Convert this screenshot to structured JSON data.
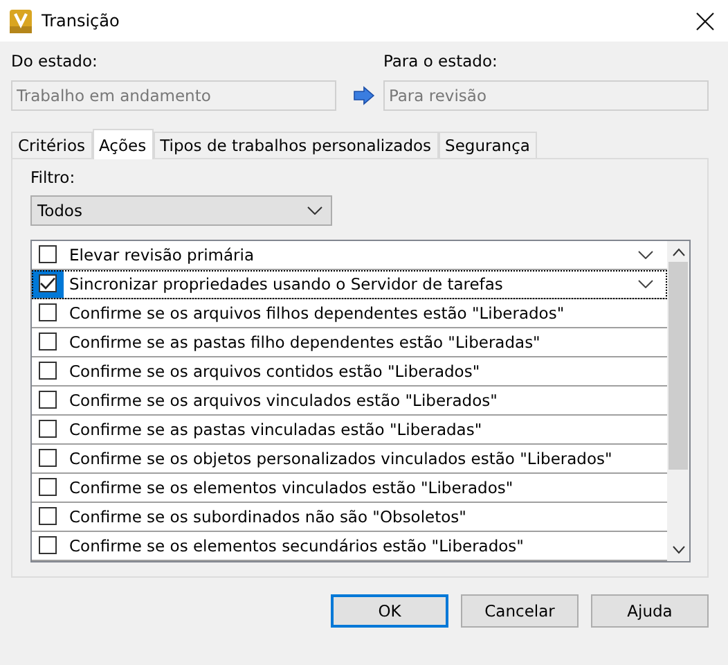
{
  "window": {
    "title": "Transição"
  },
  "from_state": {
    "label": "Do estado:",
    "value": "Trabalho em andamento",
    "disabled": true
  },
  "to_state": {
    "label": "Para o estado:",
    "value": "Para revisão",
    "disabled": true
  },
  "tabs": [
    {
      "label": "Critérios",
      "selected": false
    },
    {
      "label": "Ações",
      "selected": true
    },
    {
      "label": "Tipos de trabalhos personalizados",
      "selected": false
    },
    {
      "label": "Segurança",
      "selected": false
    }
  ],
  "filter": {
    "label": "Filtro:",
    "value": "Todos"
  },
  "actions": [
    {
      "label": "Elevar revisão primária",
      "checked": false,
      "selected": false,
      "kind": "expandable"
    },
    {
      "label": "Sincronizar propriedades usando o Servidor de tarefas",
      "checked": true,
      "selected": true,
      "kind": "expandable"
    },
    {
      "label": "Confirme se os arquivos filhos dependentes estão \"Liberados\"",
      "checked": false,
      "selected": false,
      "kind": "plain"
    },
    {
      "label": "Confirme se as pastas filho dependentes estão \"Liberadas\"",
      "checked": false,
      "selected": false,
      "kind": "plain"
    },
    {
      "label": "Confirme se os arquivos contidos estão \"Liberados\"",
      "checked": false,
      "selected": false,
      "kind": "plain"
    },
    {
      "label": "Confirme se os arquivos vinculados estão \"Liberados\"",
      "checked": false,
      "selected": false,
      "kind": "plain"
    },
    {
      "label": "Confirme se as pastas vinculadas estão \"Liberadas\"",
      "checked": false,
      "selected": false,
      "kind": "plain"
    },
    {
      "label": "Confirme se os objetos personalizados vinculados estão \"Liberados\"",
      "checked": false,
      "selected": false,
      "kind": "plain"
    },
    {
      "label": "Confirme se os elementos vinculados estão \"Liberados\"",
      "checked": false,
      "selected": false,
      "kind": "plain"
    },
    {
      "label": "Confirme se os subordinados não são \"Obsoletos\"",
      "checked": false,
      "selected": false,
      "kind": "plain"
    },
    {
      "label": "Confirme se os elementos secundários estão \"Liberados\"",
      "checked": false,
      "selected": false,
      "kind": "plain"
    }
  ],
  "buttons": [
    {
      "label": "OK",
      "default": true
    },
    {
      "label": "Cancelar",
      "default": false
    },
    {
      "label": "Ajuda",
      "default": false
    }
  ]
}
